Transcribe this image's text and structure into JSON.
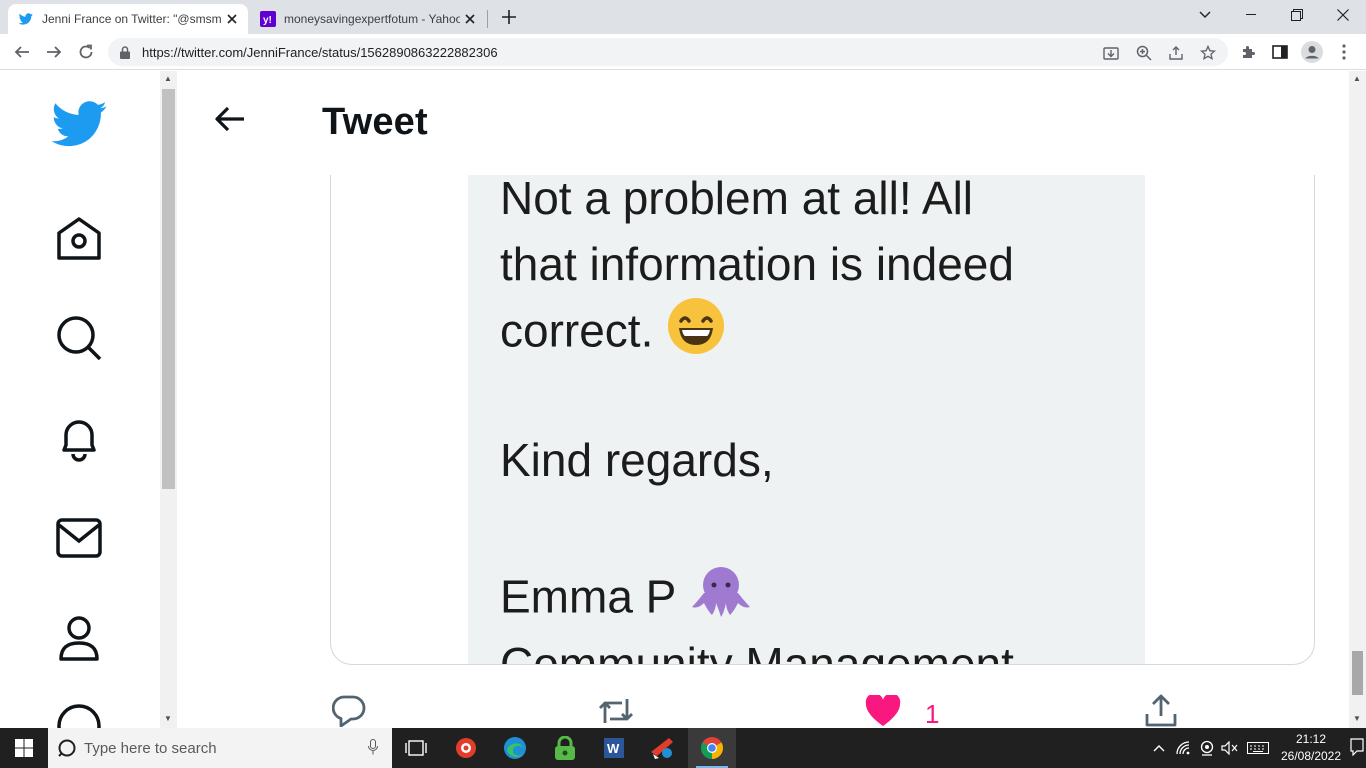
{
  "browser": {
    "tabs": [
      {
        "title": "Jenni France on Twitter: \"@smsm",
        "active": true
      },
      {
        "title": "moneysavingexpertfotum - Yahoo",
        "active": false
      }
    ],
    "url": "https://twitter.com/JenniFrance/status/1562890863222882306"
  },
  "header": {
    "title": "Tweet"
  },
  "dm_message": {
    "lines": [
      "Not a problem at all! All",
      "that information is indeed",
      "correct.",
      "Kind regards,",
      "Emma P",
      "Community Management"
    ]
  },
  "tweet_actions": {
    "like_count": "1"
  },
  "taskbar": {
    "search_placeholder": "Type here to search",
    "time": "21:12",
    "date": "26/08/2022"
  },
  "colors": {
    "twitter_blue": "#1d9bf0",
    "like_pink": "#f91880"
  }
}
